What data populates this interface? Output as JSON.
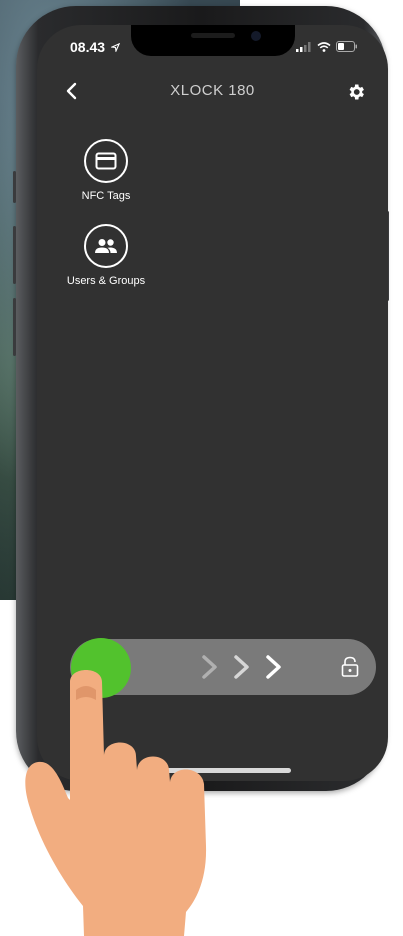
{
  "status_bar": {
    "time": "08.43"
  },
  "header": {
    "title": "XLOCK 180"
  },
  "menu": {
    "items": [
      {
        "label": "NFC Tags",
        "icon": "nfc-card-icon"
      },
      {
        "label": "Users & Groups",
        "icon": "users-icon"
      }
    ]
  },
  "slider": {
    "action": "slide-to-unlock",
    "knob_color": "#52c22d"
  },
  "colors": {
    "screen_bg": "#313131",
    "slider_bg": "#7a7a7a",
    "accent": "#52c22d",
    "hand": "#f2ad80"
  }
}
